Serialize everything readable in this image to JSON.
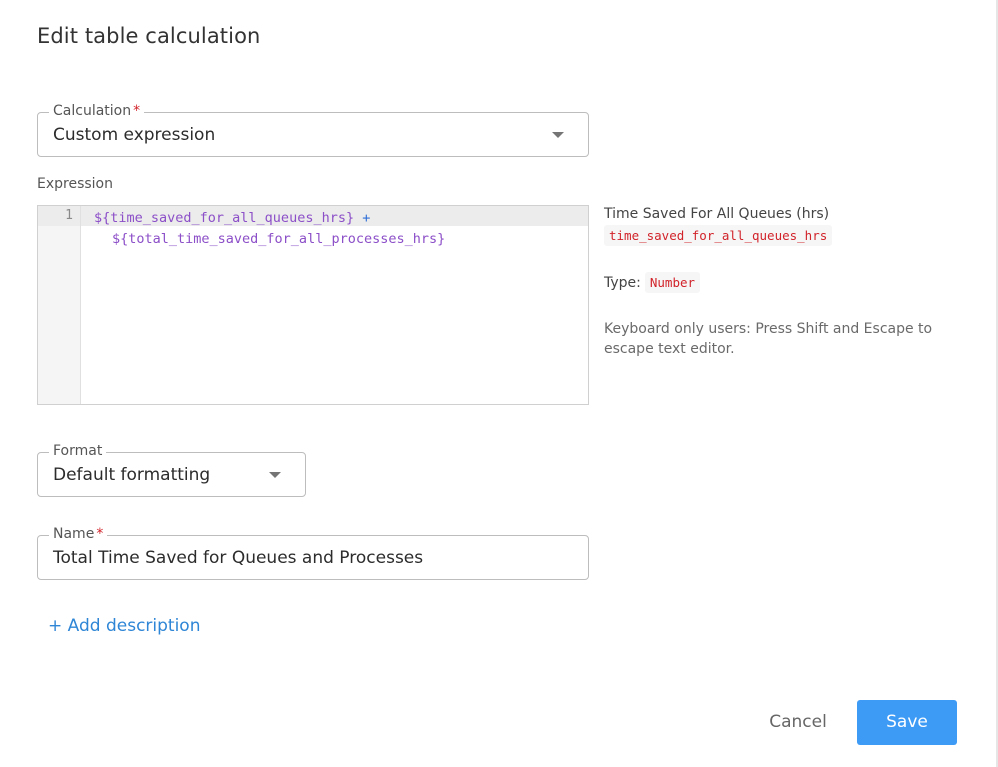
{
  "dialog": {
    "title": "Edit table calculation"
  },
  "calculation": {
    "label": "Calculation",
    "required_mark": "*",
    "value": "Custom expression",
    "icon": "chevron-down-icon"
  },
  "expression": {
    "label": "Expression",
    "line_number": "1",
    "code_line_1": "${time_saved_for_all_queues_hrs}",
    "operator": "+",
    "code_line_2": "${total_time_saved_for_all_processes_hrs}"
  },
  "info": {
    "field_title": "Time Saved For All Queues (hrs)",
    "field_name": "time_saved_for_all_queues_hrs",
    "type_label": "Type:",
    "type_value": "Number",
    "keyboard_note": "Keyboard only users: Press Shift and Escape to escape text editor."
  },
  "format": {
    "label": "Format",
    "value": "Default formatting",
    "icon": "chevron-down-icon"
  },
  "name": {
    "label": "Name",
    "required_mark": "*",
    "value": "Total Time Saved for Queues and Processes"
  },
  "actions": {
    "add_description": "+ Add description",
    "cancel": "Cancel",
    "save": "Save"
  },
  "colors": {
    "primary": "#3d9bf6",
    "link": "#2f86d6",
    "required": "#d1232a",
    "code_variable": "#8c4fc8",
    "code_operator": "#2f6fd6",
    "chip_text": "#d1232a"
  }
}
